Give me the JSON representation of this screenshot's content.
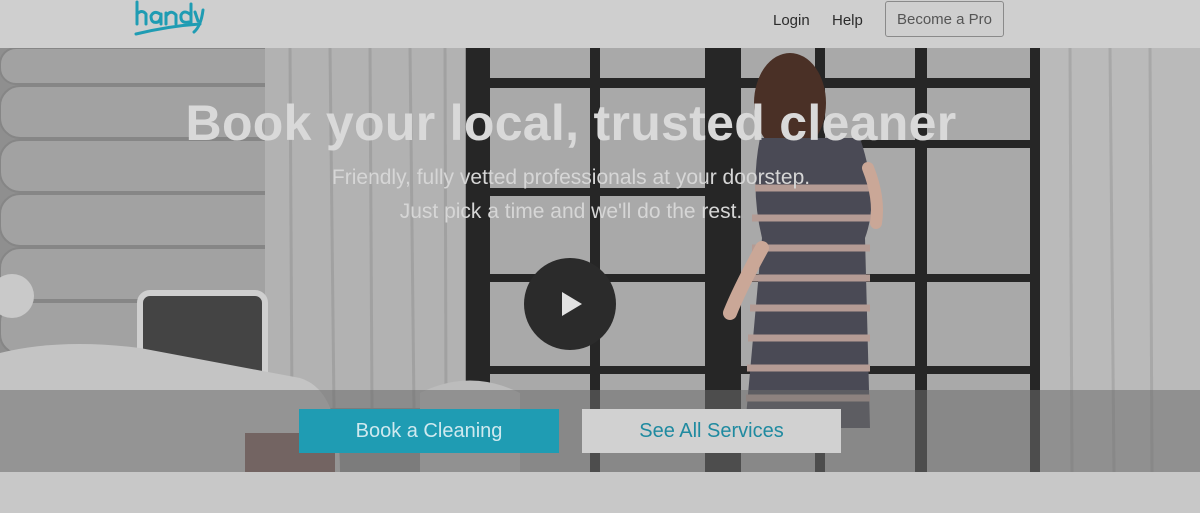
{
  "header": {
    "logo_text": "handy",
    "nav": {
      "login": "Login",
      "help": "Help"
    },
    "become_pro": "Become a Pro"
  },
  "hero": {
    "headline": "Book your local, trusted cleaner",
    "subline1": "Friendly, fully vetted professionals at your doorstep.",
    "subline2": "Just pick a time and we'll do the rest.",
    "play_icon": "play-icon"
  },
  "cta": {
    "book_label": "Book a Cleaning",
    "services_label": "See All Services"
  },
  "colors": {
    "brand_teal": "#1f9cb3",
    "overlay_gray": "#8e8e8e"
  }
}
